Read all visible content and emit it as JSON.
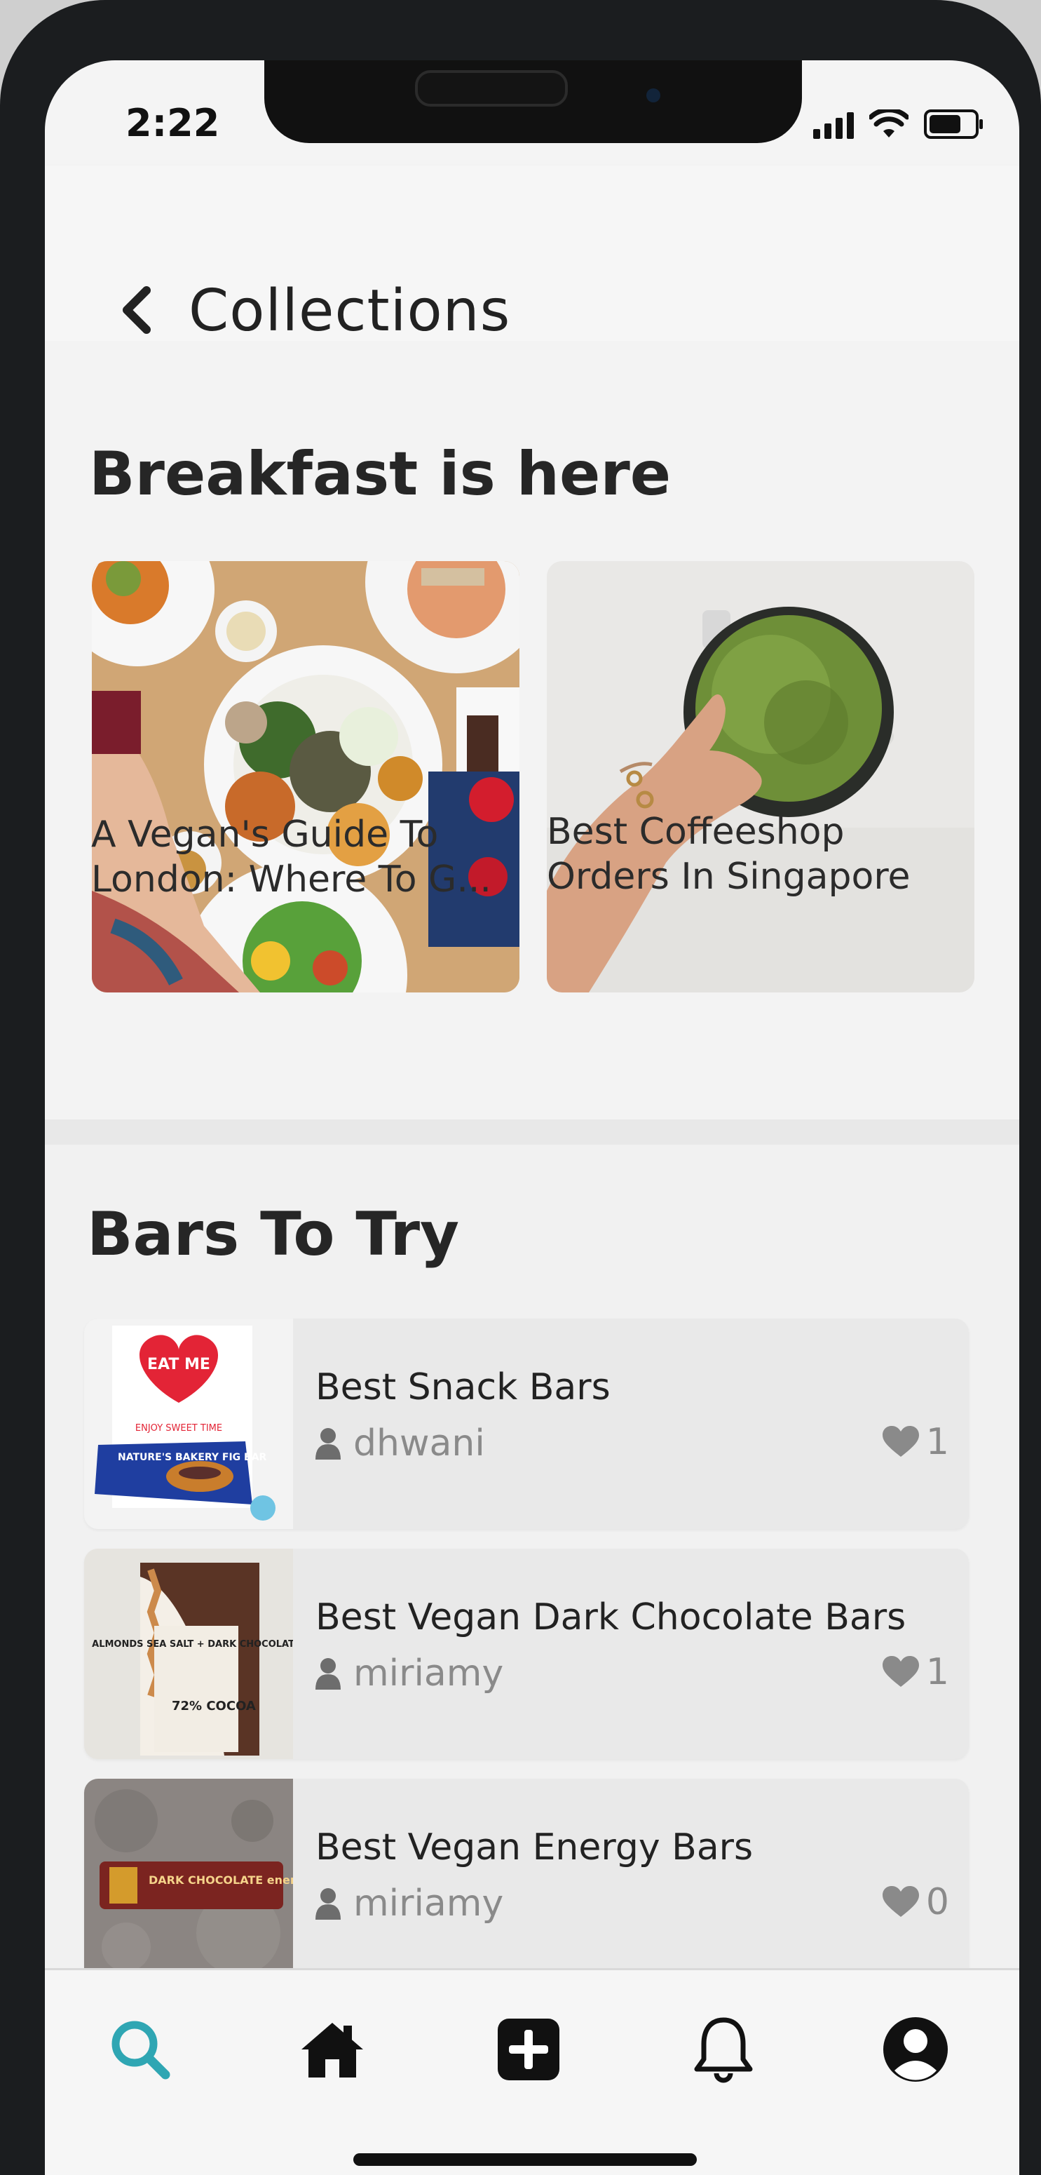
{
  "status_bar": {
    "time": "2:22"
  },
  "header": {
    "title": "Collections"
  },
  "sections": [
    {
      "title": "Breakfast is here",
      "cards": [
        {
          "caption_line1": "A Vegan's Guide To",
          "caption_line2": "London: Where To G..."
        },
        {
          "caption_line1": "Best Coffeeshop",
          "caption_line2": "Orders In Singapore"
        }
      ]
    },
    {
      "title": "Bars To Try",
      "items": [
        {
          "title": "Best Snack Bars",
          "author": "dhwani",
          "likes": "1"
        },
        {
          "title": "Best Vegan Dark Chocolate Bars",
          "author": "miriamy",
          "likes": "1"
        },
        {
          "title": "Best Vegan Energy Bars",
          "author": "miriamy",
          "likes": "0"
        }
      ]
    }
  ],
  "thumb_text": {
    "snack_heart": "EAT ME",
    "snack_tag": "ENJOY SWEET TIME",
    "snack_pack": "NATURE'S BAKERY FIG BAR",
    "choc_label": "ALMONDS SEA SALT + DARK CHOCOLATE",
    "choc_pct": "72% COCOA",
    "energy_label": "DARK CHOCOLATE energy bar"
  },
  "tab_bar": {
    "icons": [
      "search-icon",
      "home-icon",
      "add-icon",
      "bell-icon",
      "profile-icon"
    ],
    "active": "search-icon"
  },
  "colors": {
    "accent": "#2fa6b3",
    "text_primary": "#222222",
    "text_secondary": "#8a8a8a"
  }
}
